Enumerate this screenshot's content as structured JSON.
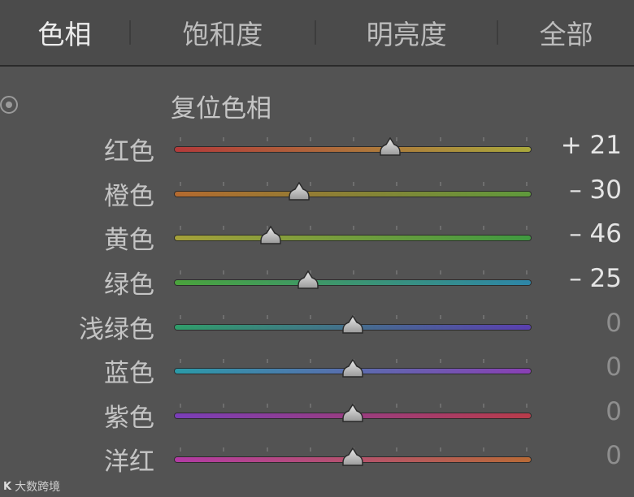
{
  "tabs": [
    {
      "label": "色相",
      "active": true
    },
    {
      "label": "饱和度",
      "active": false
    },
    {
      "label": "明亮度",
      "active": false
    },
    {
      "label": "全部",
      "active": false
    }
  ],
  "reset_label": "复位色相",
  "target_icon": "target-adjust-icon",
  "slider_range": [
    -100,
    100
  ],
  "sliders": [
    {
      "label": "红色",
      "value": 21,
      "display": "+ 21",
      "colors": [
        "#b33a3a",
        "#a9a83c"
      ]
    },
    {
      "label": "橙色",
      "value": -30,
      "display": "– 30",
      "colors": [
        "#b46a2f",
        "#5f9a3c"
      ]
    },
    {
      "label": "黄色",
      "value": -46,
      "display": "– 46",
      "colors": [
        "#a5a03a",
        "#3f9a40"
      ]
    },
    {
      "label": "绿色",
      "value": -25,
      "display": "– 25",
      "colors": [
        "#4aa33c",
        "#2e86a8"
      ]
    },
    {
      "label": "浅绿色",
      "value": 0,
      "display": "0",
      "colors": [
        "#2f9d6a",
        "#5a3fb0"
      ]
    },
    {
      "label": "蓝色",
      "value": 0,
      "display": "0",
      "colors": [
        "#2a9aa8",
        "#8a3fb4"
      ]
    },
    {
      "label": "紫色",
      "value": 0,
      "display": "0",
      "colors": [
        "#7a3eb8",
        "#b83c4a"
      ]
    },
    {
      "label": "洋红",
      "value": 0,
      "display": "0",
      "colors": [
        "#b23aa4",
        "#b86a36"
      ]
    }
  ],
  "watermark": {
    "logo": "K",
    "text": "大数跨境"
  }
}
